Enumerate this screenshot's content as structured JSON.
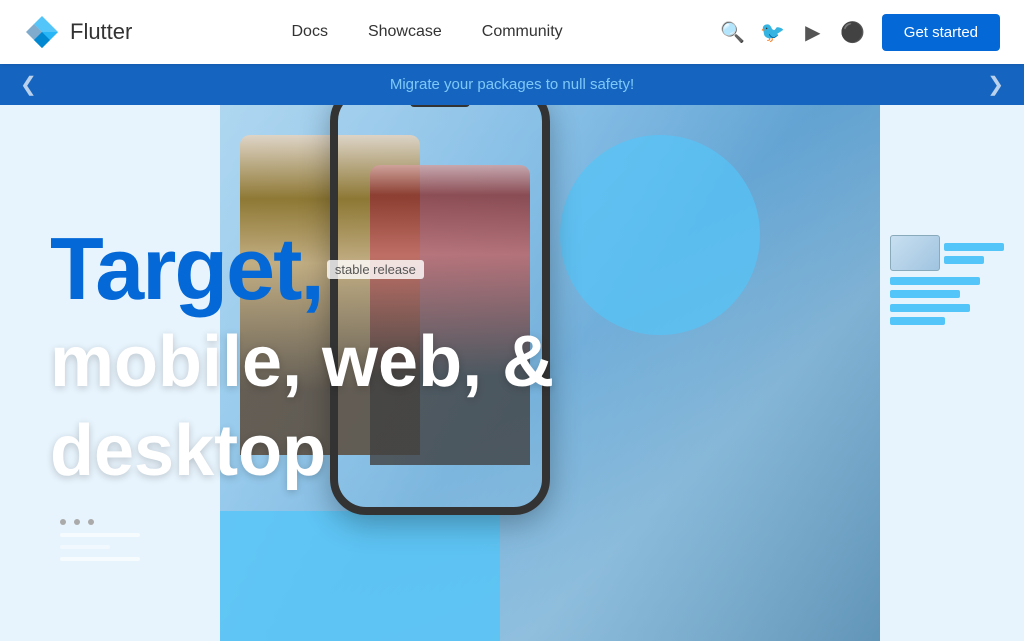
{
  "navbar": {
    "brand": "Flutter",
    "logo_alt": "Flutter logo",
    "nav_links": [
      {
        "id": "docs",
        "label": "Docs"
      },
      {
        "id": "showcase",
        "label": "Showcase"
      },
      {
        "id": "community",
        "label": "Community"
      }
    ],
    "get_started_label": "Get started",
    "icons": {
      "search": "🔍",
      "twitter": "🐦",
      "youtube": "▶",
      "github": "⚫"
    }
  },
  "banner": {
    "text": "Migrate your packages to null safety!",
    "arrow_left": "❮",
    "arrow_right": "❯"
  },
  "hero": {
    "line1": "Target,",
    "release_badge": "stable release",
    "line2": "mobile, web, &",
    "line3": "desktop"
  }
}
